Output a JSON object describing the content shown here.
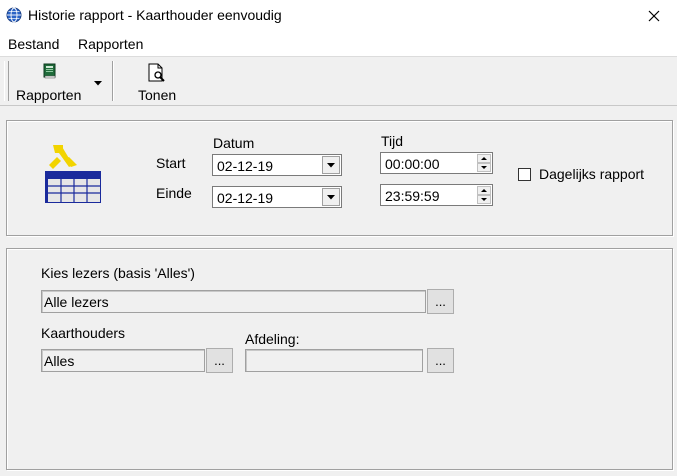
{
  "window": {
    "title": "Historie rapport - Kaarthouder eenvoudig",
    "close_glyph": "✕"
  },
  "menu": [
    {
      "label": "Bestand"
    },
    {
      "label": "Rapporten"
    }
  ],
  "toolbar": {
    "rapporten_label": "Rapporten",
    "tonen_label": "Tonen"
  },
  "date_section": {
    "datum_header": "Datum",
    "tijd_header": "Tijd",
    "start_label": "Start",
    "einde_label": "Einde",
    "start_date": "02-12-19",
    "end_date": "02-12-19",
    "start_time": "00:00:00",
    "end_time": "23:59:59",
    "daily_report_label": "Dagelijks rapport",
    "daily_report_checked": false
  },
  "filter_section": {
    "readers_label": "Kies lezers (basis 'Alles')",
    "readers_value": "Alle lezers",
    "cardholders_label": "Kaarthouders",
    "cardholders_value": "Alles",
    "department_label": "Afdeling:",
    "department_value": "",
    "browse_label": "..."
  },
  "icons": {
    "app": "globe-icon",
    "rapporten": "report-book-icon",
    "tonen": "preview-magnifier-icon",
    "report": "report-table-icon",
    "close": "close-icon",
    "dropdown": "triangle-down-icon"
  },
  "colors": {
    "titlebar_bg": "#ffffff",
    "window_bg": "#f0f0f0",
    "input_bg": "#ffffff",
    "report_icon_blue": "#1a2a9c",
    "report_icon_yellow": "#f2d400"
  }
}
